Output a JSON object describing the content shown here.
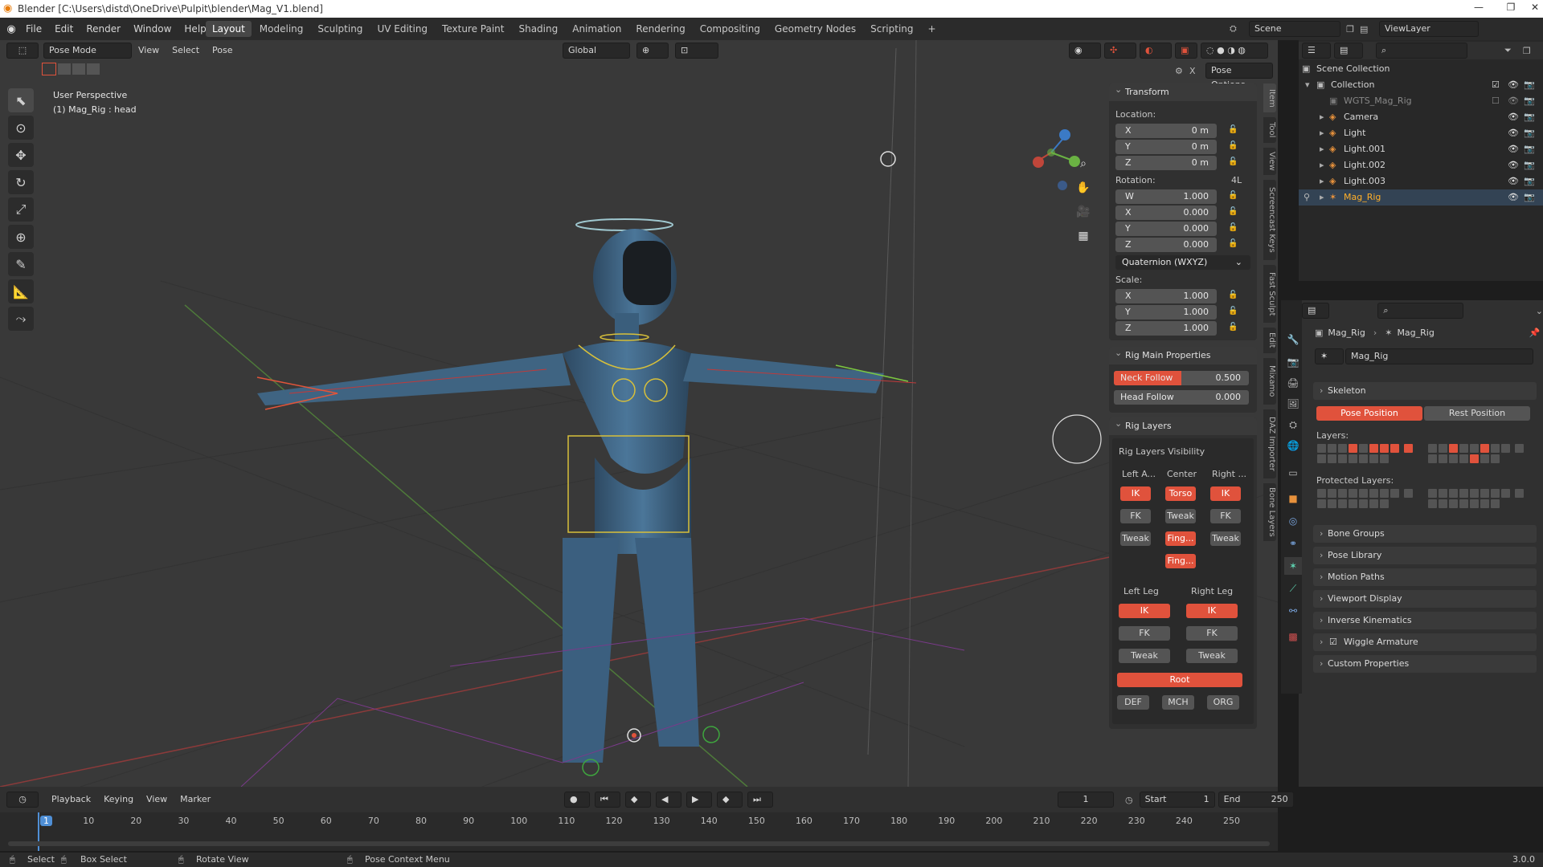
{
  "titlebar": {
    "title": "Blender [C:\\Users\\distd\\OneDrive\\Pulpit\\blender\\Mag_V1.blend]"
  },
  "menu": [
    "File",
    "Edit",
    "Render",
    "Window",
    "Help"
  ],
  "workspaces": [
    "Layout",
    "Modeling",
    "Sculpting",
    "UV Editing",
    "Texture Paint",
    "Shading",
    "Animation",
    "Rendering",
    "Compositing",
    "Geometry Nodes",
    "Scripting"
  ],
  "active_workspace": "Layout",
  "scene": {
    "name": "Scene",
    "view_layer": "ViewLayer"
  },
  "viewport": {
    "mode": "Pose Mode",
    "menus": [
      "View",
      "Select",
      "Pose"
    ],
    "transform_orientation": "Global",
    "pose_options": "Pose Options",
    "overlay_text": [
      "User Perspective",
      "(1) Mag_Rig : head"
    ]
  },
  "npanel": {
    "transform": {
      "title": "Transform",
      "location_label": "Location:",
      "location": [
        {
          "axis": "X",
          "value": "0 m"
        },
        {
          "axis": "Y",
          "value": "0 m"
        },
        {
          "axis": "Z",
          "value": "0 m"
        }
      ],
      "rotation_label": "Rotation:",
      "rotation_mode_tag": "4L",
      "rotation": [
        {
          "axis": "W",
          "value": "1.000"
        },
        {
          "axis": "X",
          "value": "0.000"
        },
        {
          "axis": "Y",
          "value": "0.000"
        },
        {
          "axis": "Z",
          "value": "0.000"
        }
      ],
      "rotation_mode": "Quaternion (WXYZ)",
      "scale_label": "Scale:",
      "scale": [
        {
          "axis": "X",
          "value": "1.000"
        },
        {
          "axis": "Y",
          "value": "1.000"
        },
        {
          "axis": "Z",
          "value": "1.000"
        }
      ]
    },
    "rig_main": {
      "title": "Rig Main Properties",
      "neck_follow": {
        "label": "Neck Follow",
        "value": "0.500"
      },
      "head_follow": {
        "label": "Head Follow",
        "value": "0.000"
      }
    },
    "rig_layers": {
      "title": "Rig Layers",
      "visibility_label": "Rig Layers Visibility",
      "left_arm": "Left A...",
      "center": "Center",
      "right_arm": "Right ...",
      "ik": "IK",
      "fk": "FK",
      "tweak": "Tweak",
      "torso": "Torso",
      "fing1": "Fing...",
      "fing2": "Fing...",
      "left_leg": "Left Leg",
      "right_leg": "Right Leg",
      "root": "Root",
      "def": "DEF",
      "mch": "MCH",
      "org": "ORG"
    },
    "tabs": [
      "Item",
      "Tool",
      "View",
      "Screencast Keys",
      "Fast Sculpt",
      "Edit",
      "Mixamo",
      "DAZ Importer",
      "Bone Layers"
    ]
  },
  "outliner": {
    "root": "Scene Collection",
    "items": [
      {
        "name": "Collection"
      },
      {
        "name": "WGTS_Mag_Rig"
      },
      {
        "name": "Camera"
      },
      {
        "name": "Light"
      },
      {
        "name": "Light.001"
      },
      {
        "name": "Light.002"
      },
      {
        "name": "Light.003"
      },
      {
        "name": "Mag_Rig"
      }
    ]
  },
  "properties": {
    "breadcrumb": [
      "Mag_Rig",
      "Mag_Rig"
    ],
    "data_name": "Mag_Rig",
    "skeleton": {
      "title": "Skeleton",
      "pose_position": "Pose Position",
      "rest_position": "Rest Position",
      "layers_label": "Layers:",
      "protected_label": "Protected Layers:"
    },
    "sections": [
      "Bone Groups",
      "Pose Library",
      "Motion Paths",
      "Viewport Display",
      "Inverse Kinematics",
      "Wiggle Armature",
      "Custom Properties"
    ]
  },
  "timeline": {
    "menus": [
      "Playback",
      "Keying",
      "View",
      "Marker"
    ],
    "current_frame": "1",
    "start_label": "Start",
    "start": "1",
    "end_label": "End",
    "end": "250",
    "ticks": [
      "1",
      "10",
      "20",
      "30",
      "40",
      "50",
      "60",
      "70",
      "80",
      "90",
      "100",
      "110",
      "120",
      "130",
      "140",
      "150",
      "160",
      "170",
      "180",
      "190",
      "200",
      "210",
      "220",
      "230",
      "240",
      "250"
    ]
  },
  "statusbar": {
    "select": "Select",
    "box_select": "Box Select",
    "rotate_view": "Rotate View",
    "context_menu": "Pose Context Menu",
    "version": "3.0.0"
  },
  "colors": {
    "accent": "#e0523c",
    "active_object": "#ffaf29"
  }
}
